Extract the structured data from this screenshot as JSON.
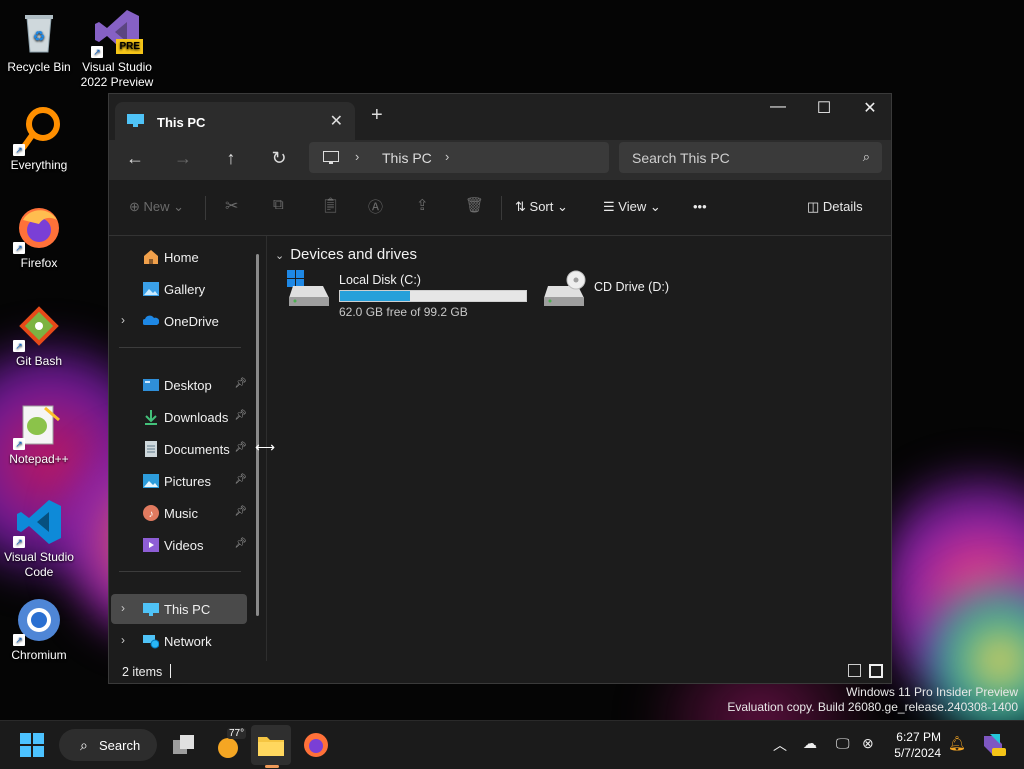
{
  "desktop": {
    "icons": [
      {
        "label": "Recycle Bin",
        "icon": "recycle-bin-icon"
      },
      {
        "label": "Visual Studio 2022 Preview",
        "icon": "visual-studio-icon",
        "badge": "PRE"
      },
      {
        "label": "Everything",
        "icon": "everything-search-icon"
      },
      {
        "label": "Firefox",
        "icon": "firefox-icon"
      },
      {
        "label": "Git Bash",
        "icon": "git-bash-icon"
      },
      {
        "label": "Notepad++",
        "icon": "notepadpp-icon"
      },
      {
        "label": "Visual Studio Code",
        "icon": "vscode-icon"
      },
      {
        "label": "Chromium",
        "icon": "chromium-icon"
      }
    ]
  },
  "explorer": {
    "tab_title": "This PC",
    "new_tab": "+",
    "window_controls": {
      "minimize": "—",
      "maximize": "☐",
      "close": "✕"
    },
    "nav": {
      "back": "←",
      "forward": "→",
      "up": "↑",
      "refresh": "↻"
    },
    "address": {
      "crumb": "This PC",
      "sep": "›"
    },
    "search_placeholder": "Search This PC",
    "commands": {
      "new": "New",
      "sort": "Sort",
      "view": "View",
      "more": "•••",
      "details": "Details"
    },
    "sidebar": {
      "top": [
        {
          "label": "Home"
        },
        {
          "label": "Gallery"
        },
        {
          "label": "OneDrive"
        }
      ],
      "pinned": [
        {
          "label": "Desktop"
        },
        {
          "label": "Downloads"
        },
        {
          "label": "Documents"
        },
        {
          "label": "Pictures"
        },
        {
          "label": "Music"
        },
        {
          "label": "Videos"
        }
      ],
      "bottom": [
        {
          "label": "This PC"
        },
        {
          "label": "Network"
        }
      ]
    },
    "group_title": "Devices and drives",
    "drives": [
      {
        "name": "Local Disk (C:)",
        "free_text": "62.0 GB free of 99.2 GB",
        "used_fraction": 0.375
      },
      {
        "name": "CD Drive (D:)"
      }
    ],
    "status": {
      "count": "2 items"
    }
  },
  "watermark": {
    "line1": "Windows 11 Pro Insider Preview",
    "line2": "Evaluation copy. Build 26080.ge_release.240308-1400"
  },
  "taskbar": {
    "search": "Search",
    "weather": "77°",
    "time": "6:27 PM",
    "date": "5/7/2024",
    "colors": {
      "accent": "#26a0da",
      "taskbar": "#1b1b1b"
    }
  }
}
